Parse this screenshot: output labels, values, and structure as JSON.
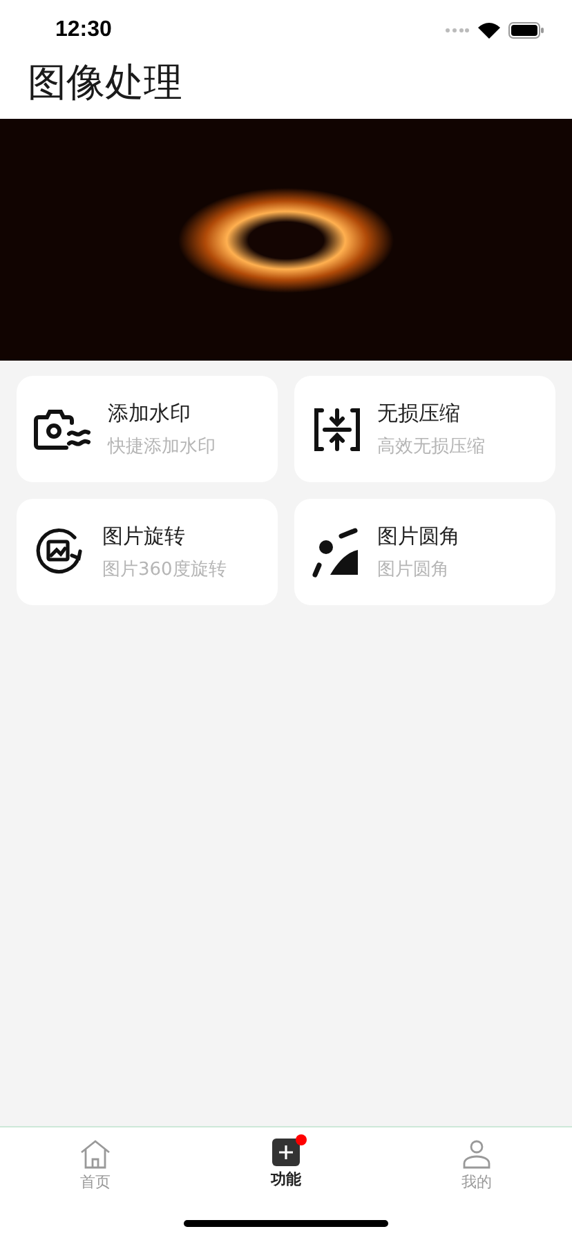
{
  "status_bar": {
    "time": "12:30"
  },
  "title": "图像处理",
  "tools": [
    {
      "kind": "watermark",
      "title": "添加水印",
      "subtitle": "快捷添加水印"
    },
    {
      "kind": "compress",
      "title": "无损压缩",
      "subtitle": "高效无损压缩"
    },
    {
      "kind": "rotate",
      "title": "图片旋转",
      "subtitle": "图片360度旋转"
    },
    {
      "kind": "corner",
      "title": "图片圆角",
      "subtitle": "图片圆角"
    }
  ],
  "tab_bar": [
    {
      "kind": "home",
      "label": "首页",
      "selected": false,
      "dot": false
    },
    {
      "kind": "plus",
      "label": "功能",
      "selected": true,
      "dot": true
    },
    {
      "kind": "user",
      "label": "我的",
      "selected": false,
      "dot": false
    }
  ]
}
